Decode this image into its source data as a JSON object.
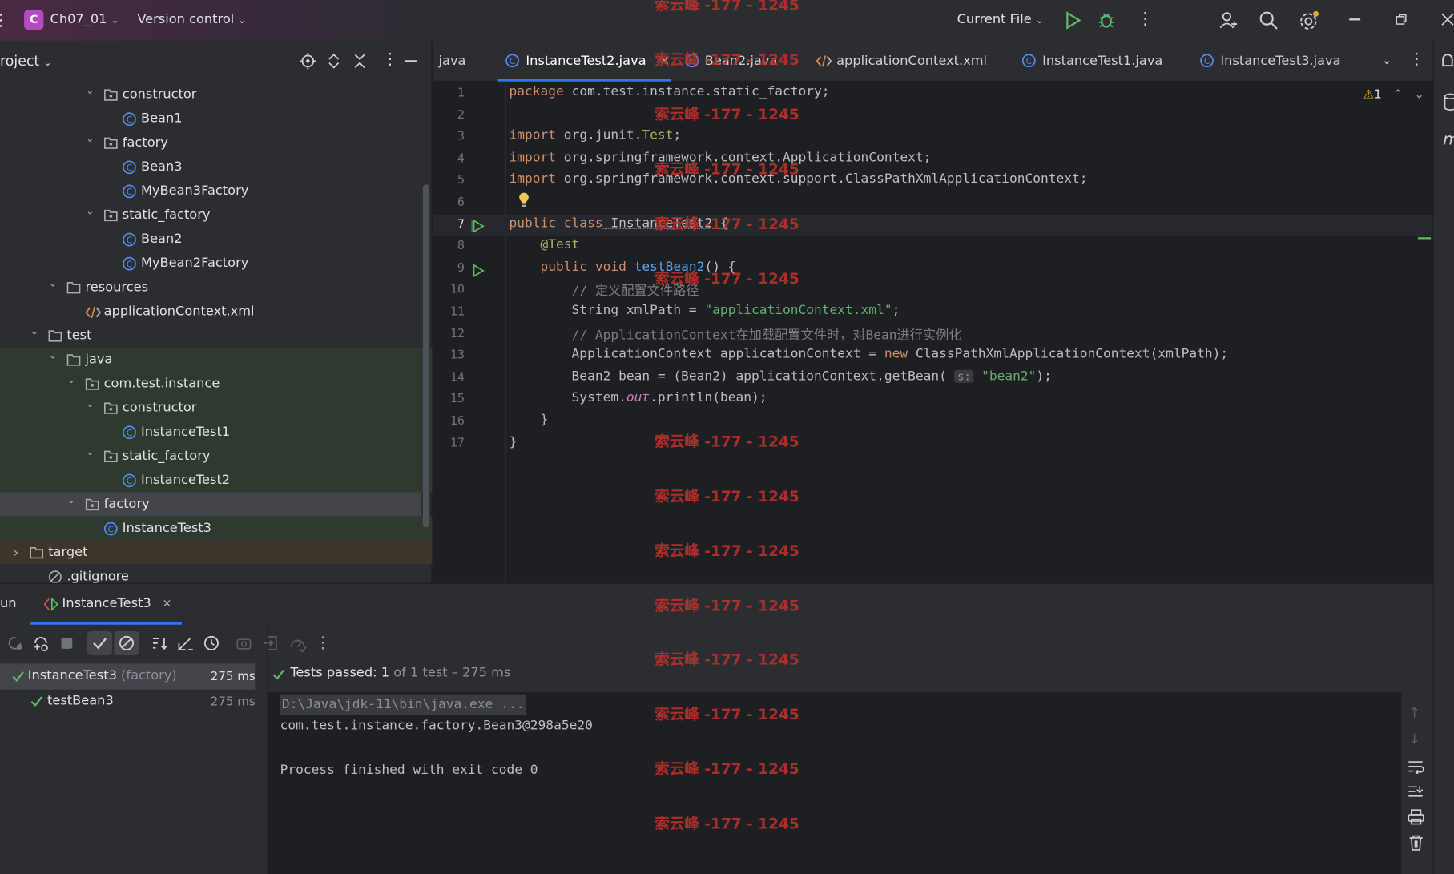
{
  "titlebar": {
    "project_initial": "C",
    "project_name": "Ch07_01",
    "vcs": "Version control",
    "run_config": "Current File"
  },
  "project_panel": {
    "title": "roject",
    "tree": [
      {
        "label": "constructor",
        "type": "package"
      },
      {
        "label": "Bean1",
        "type": "class"
      },
      {
        "label": "factory",
        "type": "package"
      },
      {
        "label": "Bean3",
        "type": "class"
      },
      {
        "label": "MyBean3Factory",
        "type": "class"
      },
      {
        "label": "static_factory",
        "type": "package"
      },
      {
        "label": "Bean2",
        "type": "class"
      },
      {
        "label": "MyBean2Factory",
        "type": "class"
      },
      {
        "label": "resources",
        "type": "folder"
      },
      {
        "label": "applicationContext.xml",
        "type": "xml"
      },
      {
        "label": "test",
        "type": "folder"
      },
      {
        "label": "java",
        "type": "folder"
      },
      {
        "label": "com.test.instance",
        "type": "package"
      },
      {
        "label": "constructor",
        "type": "package"
      },
      {
        "label": "InstanceTest1",
        "type": "class"
      },
      {
        "label": "static_factory",
        "type": "package"
      },
      {
        "label": "InstanceTest2",
        "type": "class"
      },
      {
        "label": "factory",
        "type": "package"
      },
      {
        "label": "InstanceTest3",
        "type": "class"
      },
      {
        "label": "target",
        "type": "folder"
      },
      {
        "label": ".gitignore",
        "type": "ignored"
      }
    ]
  },
  "tabs": [
    {
      "label": "java"
    },
    {
      "label": "InstanceTest2.java",
      "active": true
    },
    {
      "label": "Bean2.java"
    },
    {
      "label": "applicationContext.xml"
    },
    {
      "label": "InstanceTest1.java"
    },
    {
      "label": "InstanceTest3.java"
    }
  ],
  "editor": {
    "warning_count": "1",
    "lines": [
      {
        "n": "1",
        "segs": [
          [
            "kw",
            "package"
          ],
          [
            "cls",
            " com.test.instance.static_factory;"
          ]
        ]
      },
      {
        "n": "2",
        "segs": []
      },
      {
        "n": "3",
        "segs": [
          [
            "kw",
            "import"
          ],
          [
            "cls",
            " org.junit."
          ],
          [
            "ann",
            "Test"
          ],
          [
            "cls",
            ";"
          ]
        ]
      },
      {
        "n": "4",
        "segs": [
          [
            "kw",
            "import"
          ],
          [
            "cls",
            " org.springframework.context.ApplicationContext;"
          ]
        ]
      },
      {
        "n": "5",
        "segs": [
          [
            "kw",
            "import"
          ],
          [
            "cls",
            " org.springframework.context.support.ClassPathXmlApplicationContext;"
          ]
        ]
      },
      {
        "n": "6",
        "segs": []
      },
      {
        "n": "7",
        "segs": [
          [
            "kw",
            "public class"
          ],
          [
            "cls",
            " InstanceTest2 {"
          ]
        ]
      },
      {
        "n": "8",
        "segs": [
          [
            "ann",
            "    @Test"
          ]
        ]
      },
      {
        "n": "9",
        "segs": [
          [
            "kw",
            "    public void"
          ],
          [
            "fn",
            " testBean2"
          ],
          [
            "cls",
            "() {"
          ]
        ]
      },
      {
        "n": "10",
        "segs": [
          [
            "cmt",
            "        // 定义配置文件路径"
          ]
        ]
      },
      {
        "n": "11",
        "segs": [
          [
            "cls",
            "        String xmlPath = "
          ],
          [
            "str",
            "\"applicationContext.xml\""
          ],
          [
            "cls",
            ";"
          ]
        ]
      },
      {
        "n": "12",
        "segs": [
          [
            "cmt",
            "        // ApplicationContext在加载配置文件时，对Bean进行实例化"
          ]
        ]
      },
      {
        "n": "13",
        "segs": [
          [
            "cls",
            "        ApplicationContext applicationContext = "
          ],
          [
            "kw",
            "new"
          ],
          [
            "cls",
            " ClassPathXmlApplicationContext(xmlPath);"
          ]
        ]
      },
      {
        "n": "14",
        "segs": [
          [
            "cls",
            "        Bean2 bean = (Bean2) applicationContext.getBean( "
          ],
          [
            "hint",
            "s:"
          ],
          [
            "str",
            " \"bean2\""
          ],
          [
            "cls",
            ");"
          ]
        ]
      },
      {
        "n": "15",
        "segs": [
          [
            "cls",
            "        System."
          ],
          [
            "it",
            "out"
          ],
          [
            "cls",
            ".println(bean);"
          ]
        ]
      },
      {
        "n": "16",
        "segs": [
          [
            "cls",
            "    }"
          ]
        ]
      },
      {
        "n": "17",
        "segs": [
          [
            "cls",
            "}"
          ]
        ]
      }
    ]
  },
  "run": {
    "title": "un",
    "tab_label": "InstanceTest3",
    "tests": [
      {
        "name": "InstanceTest3",
        "suffix": "(factory)",
        "time": "275 ms"
      },
      {
        "name": "testBean3",
        "suffix": "",
        "time": "275 ms"
      }
    ],
    "status_prefix": "Tests passed: ",
    "status_count": "1",
    "status_rest": " of 1 test – 275 ms",
    "console": [
      "D:\\Java\\jdk-11\\bin\\java.exe ...",
      "com.test.instance.factory.Bean3@298a5e20",
      "",
      "Process finished with exit code 0"
    ]
  },
  "watermark": "索云峰 -177 - 1245"
}
